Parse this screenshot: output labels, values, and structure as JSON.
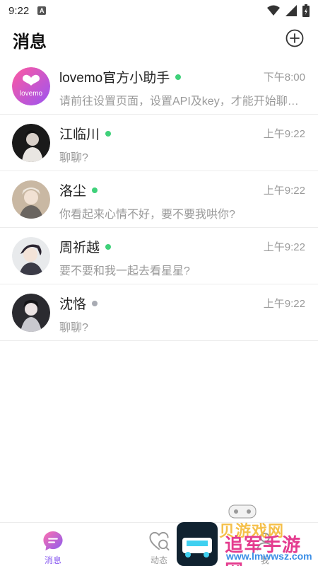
{
  "status_bar": {
    "time": "9:22",
    "app_icon_letter": "A"
  },
  "header": {
    "title": "消息",
    "add_icon": "plus-circle-icon"
  },
  "chats": [
    {
      "name": "lovemo官方小助手",
      "time": "下午8:00",
      "preview": "请前往设置页面，设置API及key，才能开始聊天哦",
      "online": true,
      "status_color": "#3fd17a",
      "avatar_label": "lovemo"
    },
    {
      "name": "江临川",
      "time": "上午9:22",
      "preview": "聊聊?",
      "online": true,
      "status_color": "#3fd17a"
    },
    {
      "name": "洛尘",
      "time": "上午9:22",
      "preview": "你看起来心情不好，要不要我哄你?",
      "online": true,
      "status_color": "#3fd17a"
    },
    {
      "name": "周祈越",
      "time": "上午9:22",
      "preview": "要不要和我一起去看星星?",
      "online": true,
      "status_color": "#3fd17a"
    },
    {
      "name": "沈恪",
      "time": "上午9:22",
      "preview": "聊聊?",
      "online": false,
      "status_color": "#a8abb3"
    }
  ],
  "bottom_nav": [
    {
      "label": "消息",
      "icon": "chat-bubble-icon",
      "active": true
    },
    {
      "label": "动态",
      "icon": "heart-search-icon",
      "active": false
    },
    {
      "label": "我",
      "icon": "profile-icon",
      "active": false
    }
  ],
  "watermark": {
    "line1": "贝游戏网",
    "line2": "追军手游网",
    "line3": "www.lmwwsz.com"
  },
  "colors": {
    "accent": "#8a5cf0",
    "online": "#3fd17a",
    "offline": "#a8abb3"
  }
}
